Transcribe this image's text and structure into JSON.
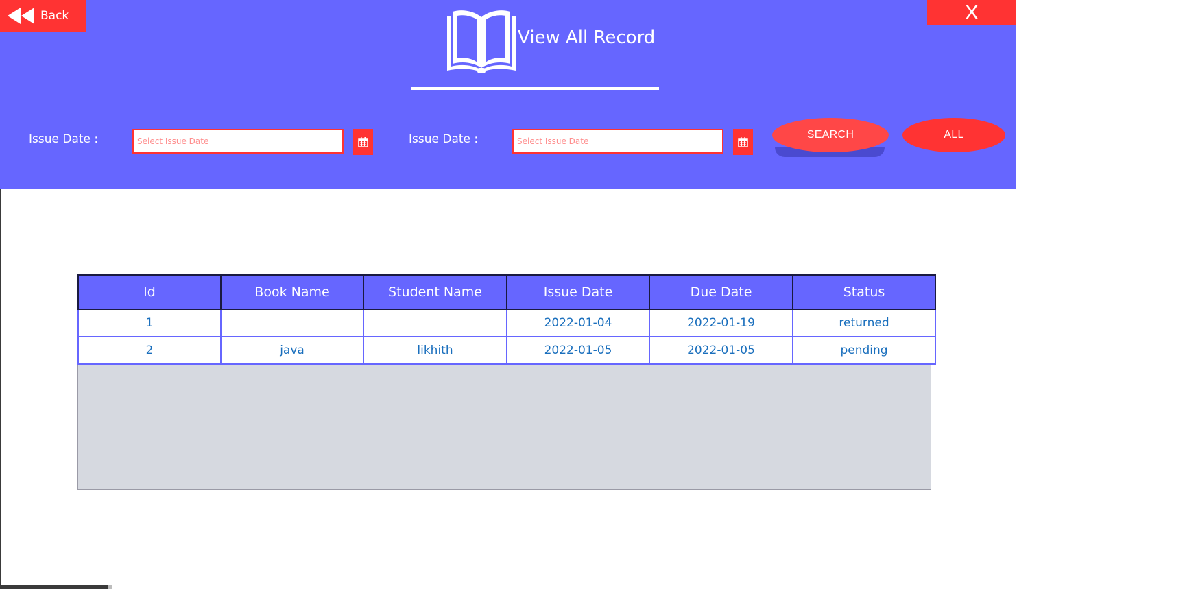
{
  "window": {
    "back_label": "Back",
    "close_label": "X",
    "title": "View All Record"
  },
  "filters": {
    "from_label": "Issue Date :",
    "from_placeholder": "Select Issue Date",
    "to_label": "Issue Date :",
    "to_placeholder": "Select Issue Date",
    "search_label": "SEARCH",
    "all_label": "ALL"
  },
  "table": {
    "columns": [
      "Id",
      "Book Name",
      "Student Name",
      "Issue Date",
      "Due Date",
      "Status"
    ],
    "rows": [
      [
        "1",
        "",
        "",
        "2022-01-04",
        "2022-01-19",
        "returned"
      ],
      [
        "2",
        "java",
        "likhith",
        "2022-01-05",
        "2022-01-05",
        "pending"
      ]
    ]
  },
  "colors": {
    "header_bg": "#6666ff",
    "accent": "#ff3333",
    "cell_text": "#1a6fbd",
    "grid_bg": "#d6d9e0"
  },
  "icons": {
    "back": "fast-rewind-icon",
    "title": "open-book-icon",
    "calendar": "calendar-icon"
  }
}
